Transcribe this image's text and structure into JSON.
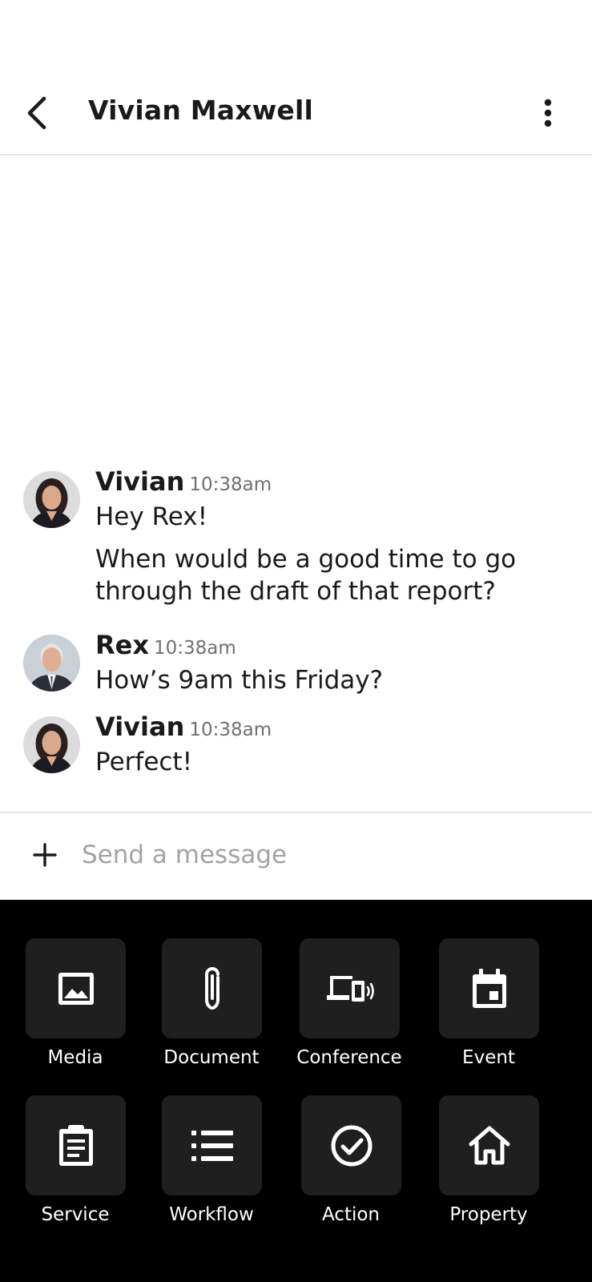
{
  "header": {
    "title": "Vivian Maxwell",
    "back_icon": "chevron-left-icon",
    "more_icon": "more-vertical-icon"
  },
  "messages": [
    {
      "sender": "Vivian",
      "time": "10:38am",
      "lines": [
        "Hey Rex!",
        "When would be a good time to go through the draft of that report?"
      ],
      "avatar": "vivian-avatar"
    },
    {
      "sender": "Rex",
      "time": "10:38am",
      "lines": [
        "How’s 9am this Friday?"
      ],
      "avatar": "rex-avatar"
    },
    {
      "sender": "Vivian",
      "time": "10:38am",
      "lines": [
        "Perfect!"
      ],
      "avatar": "vivian-avatar"
    }
  ],
  "composer": {
    "placeholder": "Send a message",
    "value": "",
    "plus_icon": "plus-icon"
  },
  "attachments": [
    {
      "label": "Media",
      "icon": "image-icon"
    },
    {
      "label": "Document",
      "icon": "paperclip-icon"
    },
    {
      "label": "Conference",
      "icon": "devices-icon"
    },
    {
      "label": "Event",
      "icon": "calendar-icon"
    },
    {
      "label": "Service",
      "icon": "clipboard-icon"
    },
    {
      "label": "Workflow",
      "icon": "list-icon"
    },
    {
      "label": "Action",
      "icon": "check-circle-icon"
    },
    {
      "label": "Property",
      "icon": "home-icon"
    }
  ],
  "colors": {
    "tray_background": "#000000",
    "tile_background": "#1f1f1f",
    "placeholder": "#a3a3a3",
    "timestamp": "#707070"
  }
}
